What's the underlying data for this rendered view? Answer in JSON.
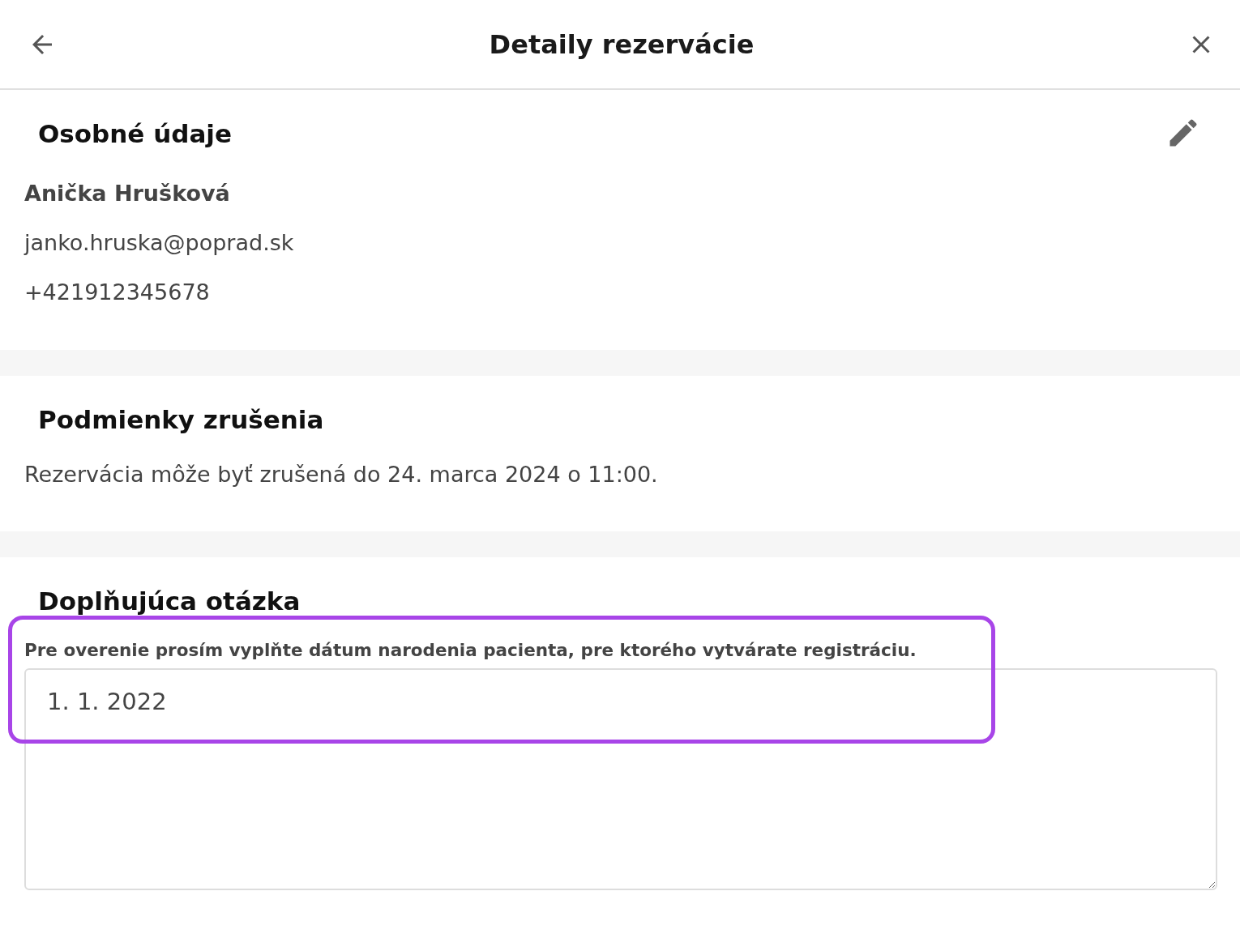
{
  "header": {
    "title": "Detaily rezervácie"
  },
  "personal": {
    "heading": "Osobné údaje",
    "name": "Anička Hrušková",
    "email": "janko.hruska@poprad.sk",
    "phone": "+421912345678"
  },
  "cancellation": {
    "heading": "Podmienky zrušenia",
    "text": "Rezervácia môže byť zrušená do 24. marca 2024 o 11:00."
  },
  "question": {
    "heading": "Doplňujúca otázka",
    "label": "Pre overenie prosím vyplňte dátum narodenia pacienta, pre ktorého vytvárate registráciu.",
    "value": "1. 1. 2022",
    "highlighted": true
  }
}
